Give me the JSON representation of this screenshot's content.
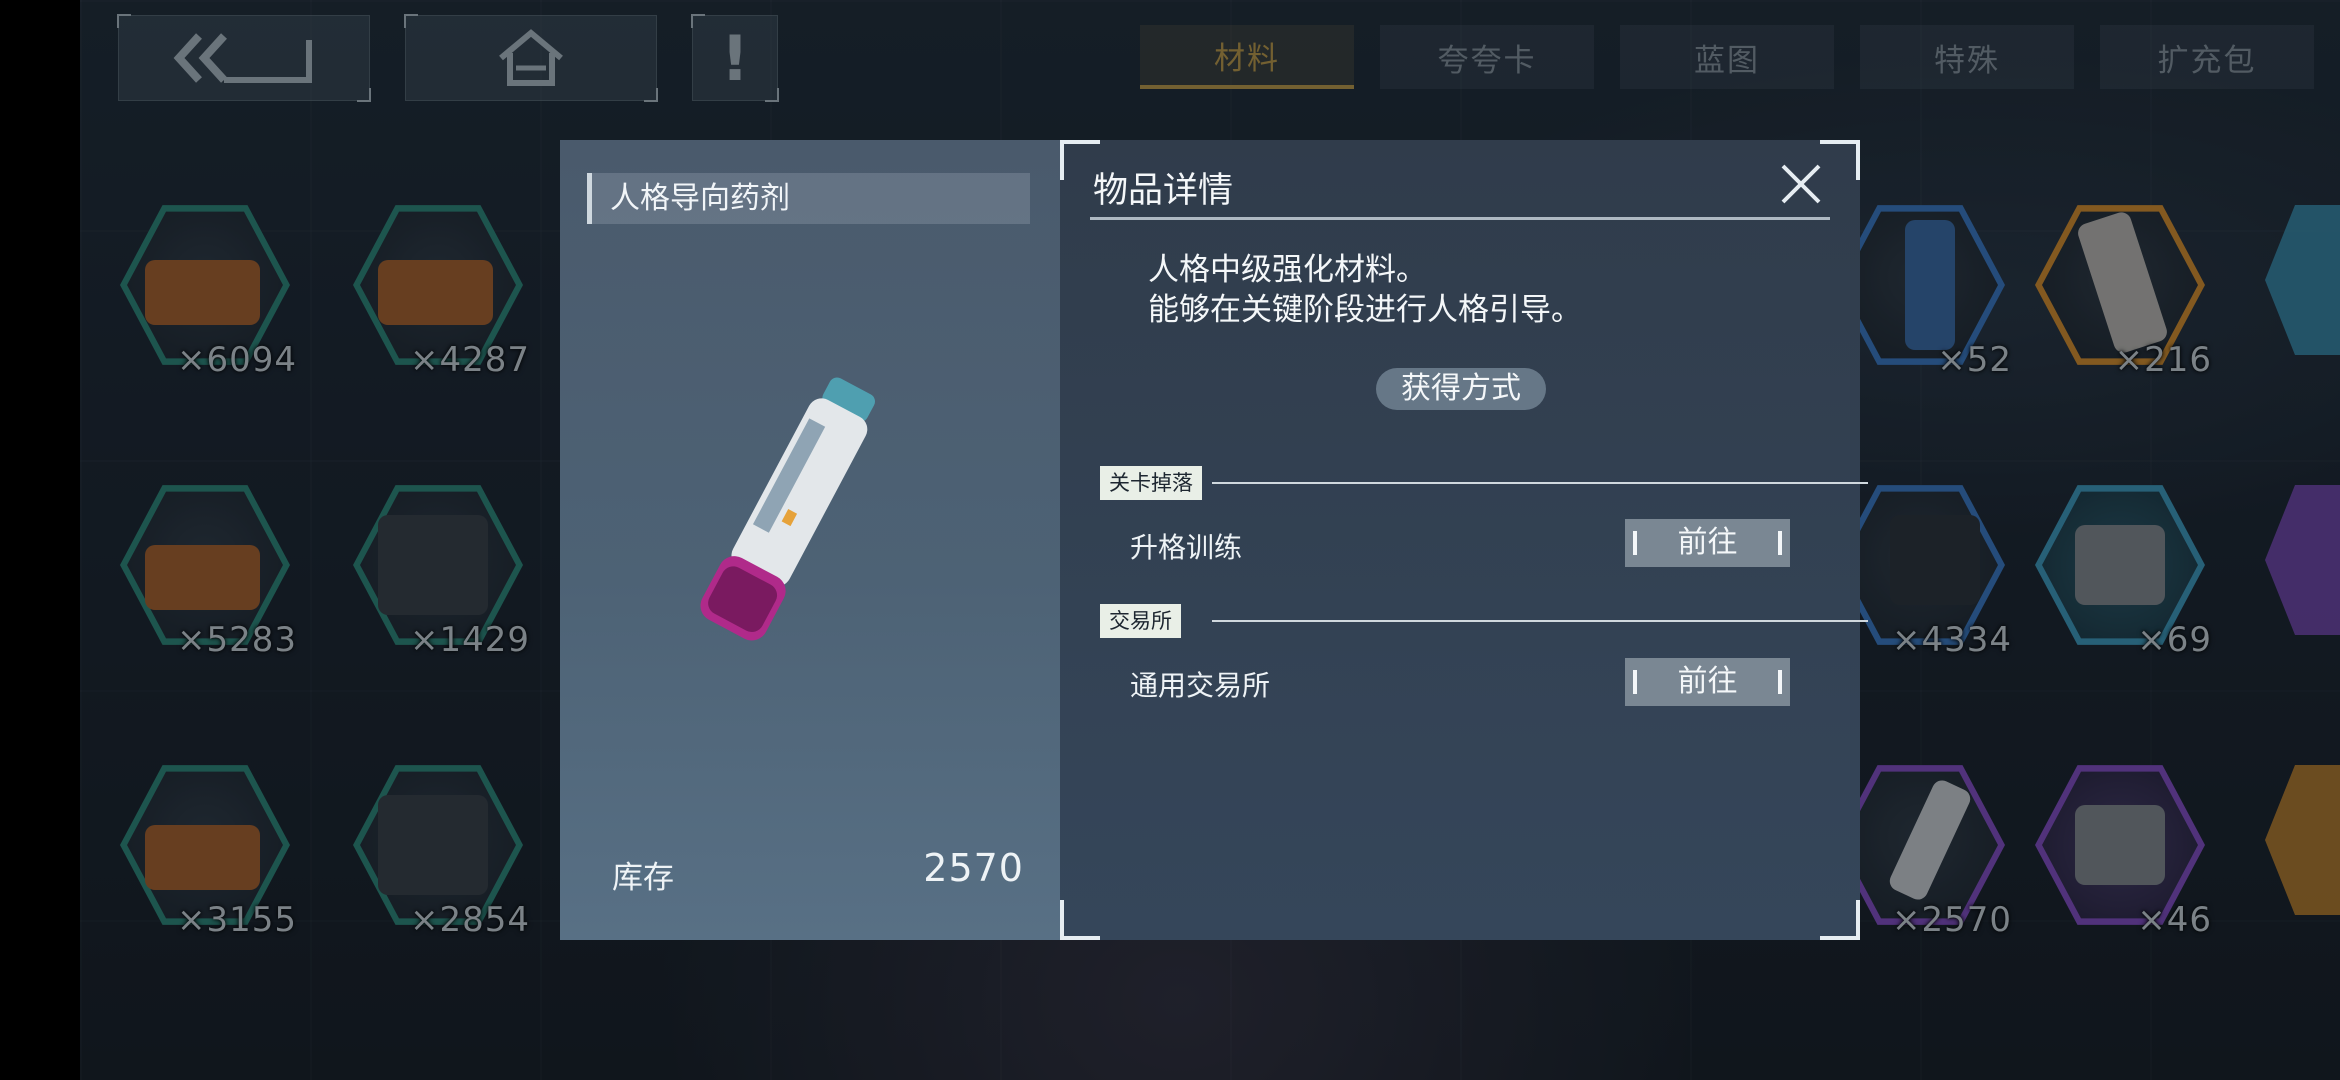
{
  "top_nav": {
    "back_icon": "back-double-chevron-icon",
    "home_icon": "home-icon",
    "alert_label": "!"
  },
  "tabs": [
    {
      "label": "材料",
      "active": true
    },
    {
      "label": "夸夸卡",
      "active": false
    },
    {
      "label": "蓝图",
      "active": false
    },
    {
      "label": "特殊",
      "active": false
    },
    {
      "label": "扩充包",
      "active": false
    }
  ],
  "inventory": [
    {
      "count": "×6094",
      "rarity_color": "#2d8f7f",
      "icon": "toolbox-icon"
    },
    {
      "count": "×4287",
      "rarity_color": "#2d8f7f",
      "icon": "toolbox-icon"
    },
    {
      "count": "×52",
      "rarity_color": "#3b7fd0",
      "icon": "spray-bottle-icon"
    },
    {
      "count": "×216",
      "rarity_color": "#e5962a",
      "icon": "device-icon"
    },
    {
      "count": "×5283",
      "rarity_color": "#2d8f7f",
      "icon": "toolbox-icon"
    },
    {
      "count": "×1429",
      "rarity_color": "#2d8f7f",
      "icon": "water-pack-icon"
    },
    {
      "count": "×4334",
      "rarity_color": "#3b7fd0",
      "icon": "gadget-icon"
    },
    {
      "count": "×69",
      "rarity_color": "#3ea3c8",
      "icon": "chip-icon"
    },
    {
      "count": "×3155",
      "rarity_color": "#2d8f7f",
      "icon": "toolbox-icon"
    },
    {
      "count": "×2854",
      "rarity_color": "#2d8f7f",
      "icon": "fire-pack-icon"
    },
    {
      "count": "×2570",
      "rarity_color": "#8a4fd0",
      "icon": "injector-icon"
    },
    {
      "count": "×46",
      "rarity_color": "#8a4fd0",
      "icon": "chip-icon"
    }
  ],
  "item_panel": {
    "name": "人格导向药剂",
    "icon": "injector-vial-icon",
    "stock_label": "库存",
    "stock_value": "2570"
  },
  "detail": {
    "title": "物品详情",
    "close_icon": "close-icon",
    "description_lines": [
      "人格中级强化材料。",
      "能够在关键阶段进行人格引导。"
    ],
    "obtain_label": "获得方式",
    "sections": [
      {
        "label": "关卡掉落",
        "source": "升格训练",
        "go_label": "前往"
      },
      {
        "label": "交易所",
        "source": "通用交易所",
        "go_label": "前往"
      }
    ]
  }
}
